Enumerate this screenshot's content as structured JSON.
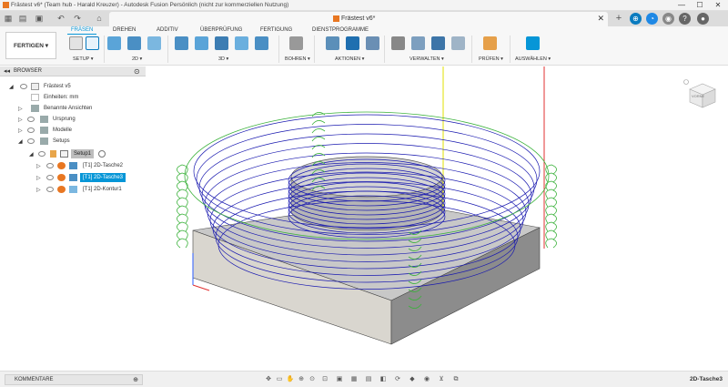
{
  "window": {
    "title": "Frästest v6* (Team hub - Harald Kreuzer) - Autodesk Fusion Persönlich (nicht zur kommerziellen Nutzung)",
    "minimize": "—",
    "maximize": "☐",
    "close": "✕"
  },
  "document_tab": {
    "label": "Frästest v6*",
    "close": "✕"
  },
  "workspace": {
    "label": "FERTIGEN ▾"
  },
  "ribbon_tabs": [
    "FRÄSEN",
    "DREHEN",
    "ADDITIV",
    "ÜBERPRÜFUNG",
    "FERTIGUNG",
    "DIENSTPROGRAMME"
  ],
  "groups": [
    "SETUP ▾",
    "2D ▾",
    "3D ▾",
    "BOHREN ▾",
    "AKTIONEN ▾",
    "VERWALTEN ▾",
    "PRÜFEN ▾",
    "AUSWÄHLEN ▾"
  ],
  "browser": {
    "title": "BROWSER",
    "items": [
      {
        "label": "Frästest v5"
      },
      {
        "label": "Einheiten: mm"
      },
      {
        "label": "Benannte Ansichten"
      },
      {
        "label": "Ursprung"
      },
      {
        "label": "Modelle"
      },
      {
        "label": "Setups"
      },
      {
        "label": "Setup1"
      },
      {
        "label": "[T1] 2D-Tasche2"
      },
      {
        "label": "[T1] 2D-Tasche3"
      },
      {
        "label": "[T1] 2D-Kontur1"
      }
    ]
  },
  "viewcube": {
    "label": "VORNE"
  },
  "comments": {
    "label": "KOMMENTARE",
    "add": "⊕"
  },
  "status": {
    "selected": "2D-Tasche3"
  },
  "colors": {
    "accent": "#0696d7",
    "toolpath_blue": "#1a1ab0",
    "toolpath_green": "#3bb23b",
    "stock_gray": "#bdbdbd"
  }
}
